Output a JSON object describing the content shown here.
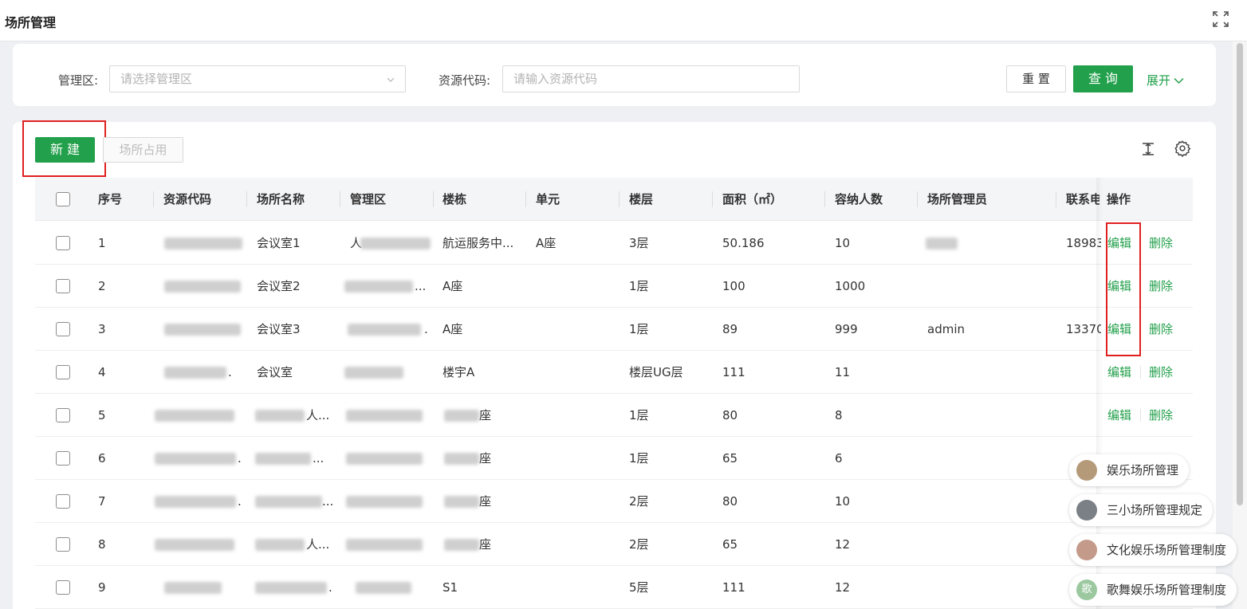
{
  "page": {
    "title": "场所管理"
  },
  "filters": {
    "area_label": "管理区:",
    "area_placeholder": "请选择管理区",
    "code_label": "资源代码:",
    "code_placeholder": "请输入资源代码",
    "reset_label": "重 置",
    "query_label": "查 询",
    "expand_label": "展开"
  },
  "toolbar": {
    "new_label": "新 建",
    "occupy_label": "场所占用"
  },
  "table": {
    "headers": {
      "index": "序号",
      "code": "资源代码",
      "name": "场所名称",
      "area": "管理区",
      "building": "楼栋",
      "unit": "单元",
      "floor": "楼层",
      "size": "面积（㎡）",
      "capacity": "容纳人数",
      "manager": "场所管理员",
      "contact": "联系电",
      "actions": "操作"
    },
    "edit_label": "编辑",
    "delete_label": "删除",
    "rows": [
      {
        "index": "1",
        "code": "",
        "name": "会议室1",
        "area": "人",
        "building": "航运服务中...",
        "unit": "A座",
        "floor": "3层",
        "size": "50.186",
        "capacity": "10",
        "manager": "",
        "contact": "18983",
        "actions": true
      },
      {
        "index": "2",
        "code": "",
        "name": "会议室2",
        "area": "...",
        "building": "A座",
        "unit": "",
        "floor": "1层",
        "size": "100",
        "capacity": "1000",
        "manager": "",
        "contact": "",
        "actions": true
      },
      {
        "index": "3",
        "code": "",
        "name": "会议室3",
        "area": ".",
        "building": "A座",
        "unit": "",
        "floor": "1层",
        "size": "89",
        "capacity": "999",
        "manager": "admin",
        "contact": "13370",
        "actions": true
      },
      {
        "index": "4",
        "code": ".",
        "name": "会议室",
        "area": "",
        "building": "楼宇A",
        "unit": "",
        "floor": "楼层UG层",
        "size": "111",
        "capacity": "11",
        "manager": "",
        "contact": "",
        "actions": true
      },
      {
        "index": "5",
        "code": "",
        "name": "人...",
        "area": "",
        "building": "座",
        "unit": "",
        "floor": "1层",
        "size": "80",
        "capacity": "8",
        "manager": "",
        "contact": "",
        "actions": true
      },
      {
        "index": "6",
        "code": ".",
        "name": "...",
        "area": "",
        "building": "座",
        "unit": "",
        "floor": "1层",
        "size": "65",
        "capacity": "6",
        "manager": "",
        "contact": "",
        "actions": false
      },
      {
        "index": "7",
        "code": ".",
        "name": "...",
        "area": "",
        "building": "座",
        "unit": "",
        "floor": "2层",
        "size": "80",
        "capacity": "10",
        "manager": "",
        "contact": "",
        "actions": false
      },
      {
        "index": "8",
        "code": "",
        "name": "人...",
        "area": "",
        "building": "座",
        "unit": "",
        "floor": "2层",
        "size": "65",
        "capacity": "12",
        "manager": "",
        "contact": "",
        "actions": false
      },
      {
        "index": "9",
        "code": "",
        "name": ".",
        "area": "",
        "building": "S1",
        "unit": "",
        "floor": "5层",
        "size": "111",
        "capacity": "12",
        "manager": "",
        "contact": "",
        "actions": false
      }
    ]
  },
  "suggestions": [
    {
      "label": "娱乐场所管理",
      "avatar_color": "#b59a7a"
    },
    {
      "label": "三小场所管理规定",
      "avatar_color": "#7b7f86"
    },
    {
      "label": "文化娱乐场所管理制度",
      "avatar_color": "#c49a8a"
    },
    {
      "label": "歌舞娱乐场所管理制度",
      "avatar_text": "歌"
    }
  ],
  "colors": {
    "primary": "#22a04b",
    "annotation": "#e02020"
  }
}
